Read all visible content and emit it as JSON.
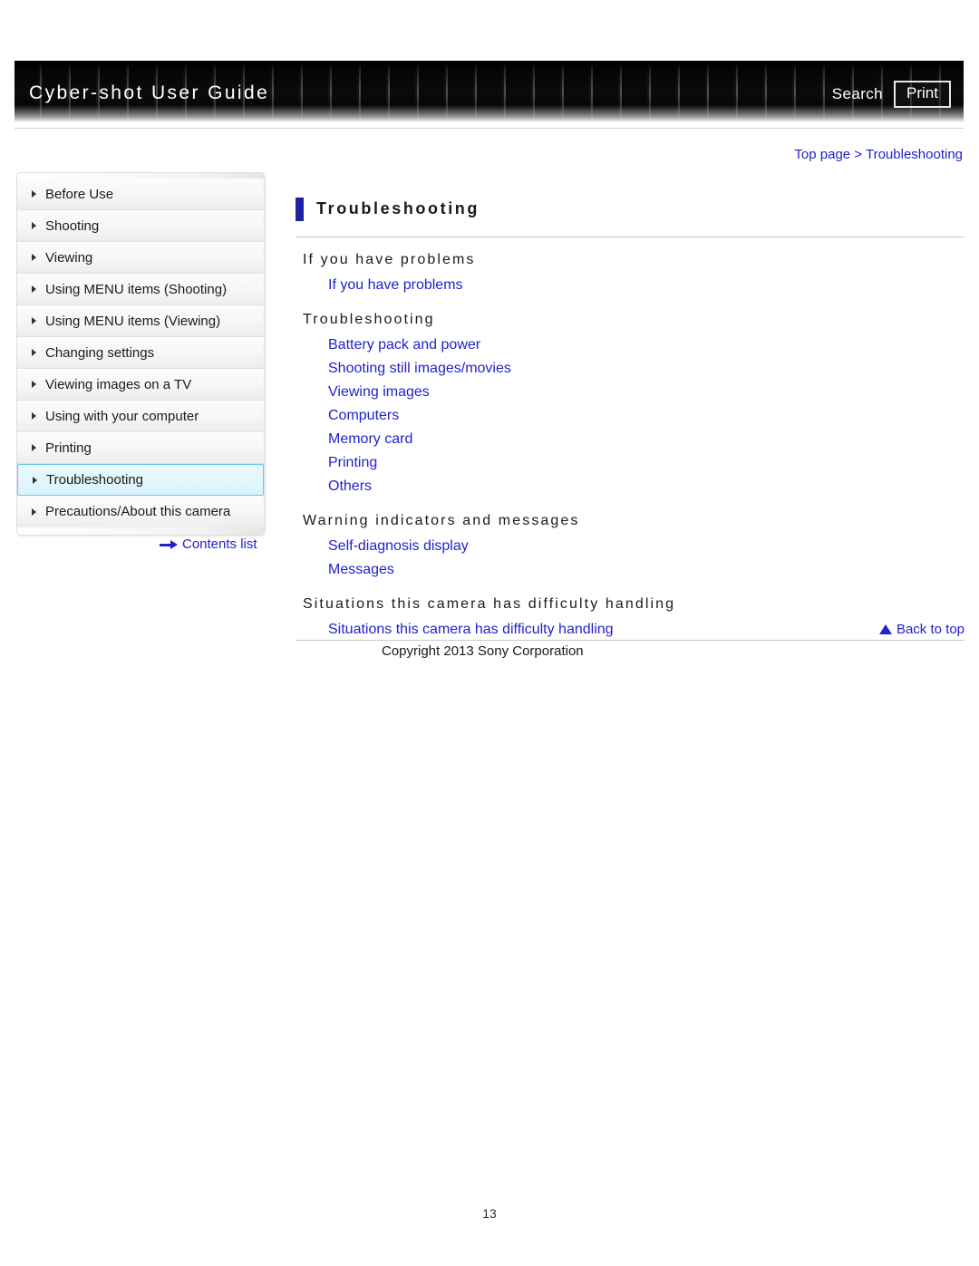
{
  "header": {
    "title": "Cyber-shot User Guide",
    "search_label": "Search",
    "print_label": "Print"
  },
  "breadcrumb": {
    "top_page": "Top page",
    "separator": ">",
    "current": "Troubleshooting",
    "full": "Top page > Troubleshooting"
  },
  "sidebar": {
    "items": [
      {
        "label": "Before Use",
        "active": false
      },
      {
        "label": "Shooting",
        "active": false
      },
      {
        "label": "Viewing",
        "active": false
      },
      {
        "label": "Using MENU items (Shooting)",
        "active": false
      },
      {
        "label": "Using MENU items (Viewing)",
        "active": false
      },
      {
        "label": "Changing settings",
        "active": false
      },
      {
        "label": "Viewing images on a TV",
        "active": false
      },
      {
        "label": "Using with your computer",
        "active": false
      },
      {
        "label": "Printing",
        "active": false
      },
      {
        "label": "Troubleshooting",
        "active": true
      },
      {
        "label": "Precautions/About this camera",
        "active": false
      }
    ],
    "contents_list_label": "Contents list"
  },
  "main": {
    "page_title": "Troubleshooting",
    "sections": [
      {
        "heading": "If you have problems",
        "links": [
          "If you have problems"
        ]
      },
      {
        "heading": "Troubleshooting",
        "links": [
          "Battery pack and power",
          "Shooting still images/movies",
          "Viewing images",
          "Computers",
          "Memory card",
          "Printing",
          "Others"
        ]
      },
      {
        "heading": "Warning indicators and messages",
        "links": [
          "Self-diagnosis display",
          "Messages"
        ]
      },
      {
        "heading": "Situations this camera has difficulty handling",
        "links": [
          "Situations this camera has difficulty handling"
        ]
      }
    ]
  },
  "footer": {
    "back_to_top_label": "Back to top",
    "copyright": "Copyright 2013 Sony Corporation",
    "page_number": "13"
  },
  "colors": {
    "link": "#2222cc",
    "title_bar": "#1f1fa8",
    "active_nav_bg": "#e2f6fc",
    "active_nav_border": "#6ec6ea",
    "header_dark": "#1c1c1c"
  }
}
